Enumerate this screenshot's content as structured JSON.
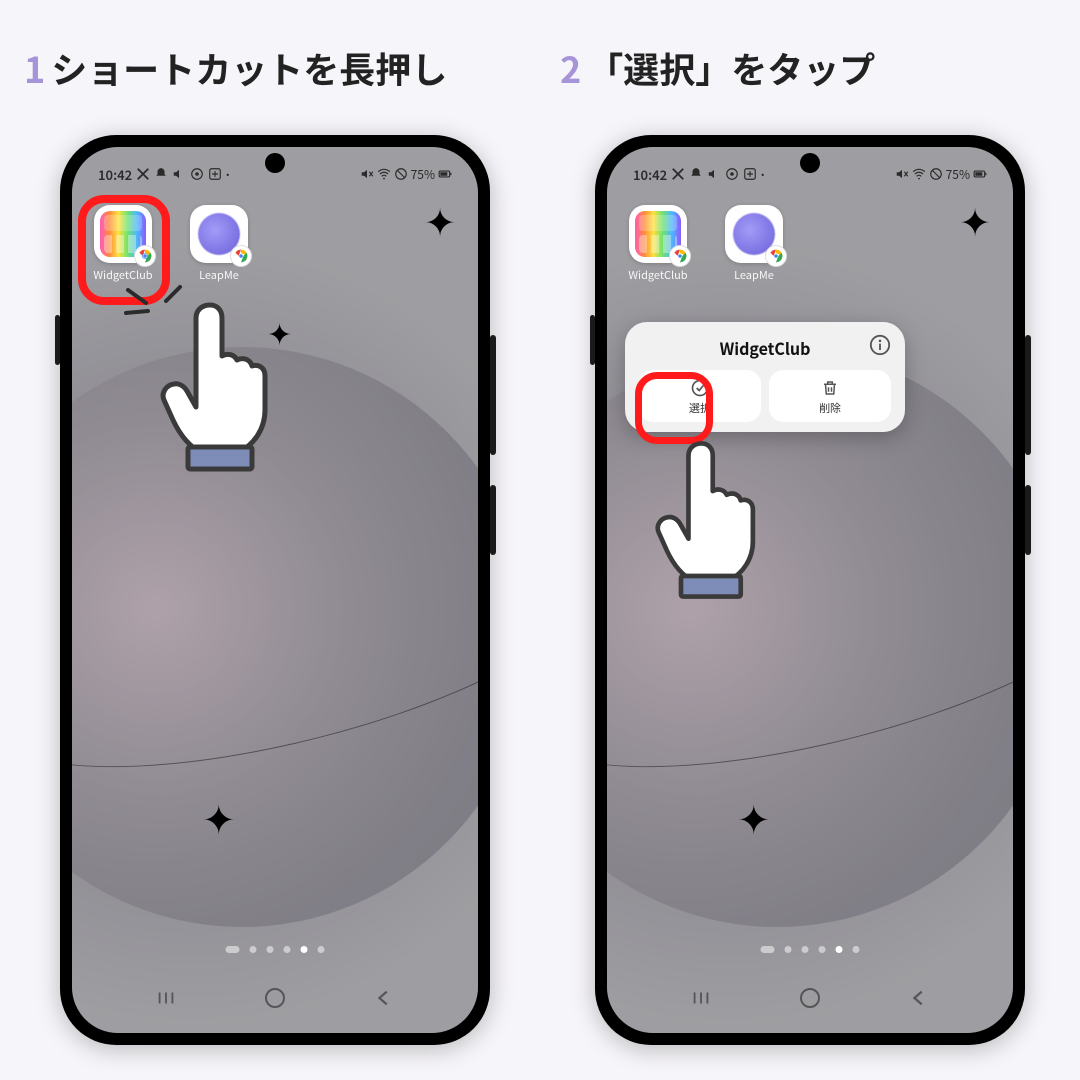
{
  "steps": {
    "one": {
      "num": "1",
      "text": "ショートカットを長押し"
    },
    "two": {
      "num": "2",
      "text": "「選択」をタップ"
    }
  },
  "status": {
    "time": "10:42",
    "battery": "75%"
  },
  "apps": {
    "widgetclub": {
      "label": "WidgetClub"
    },
    "leapme": {
      "label": "LeapMe"
    }
  },
  "popup": {
    "title": "WidgetClub",
    "select": "選択",
    "delete": "削除"
  }
}
